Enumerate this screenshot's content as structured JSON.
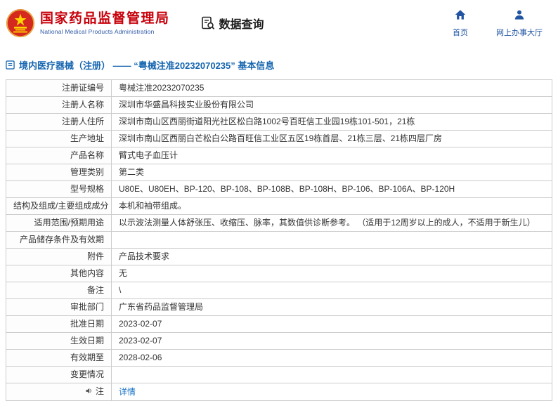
{
  "header": {
    "org_name_zh": "国家药品监督管理局",
    "org_name_en": "National Medical Products Administration",
    "nav_title": "数据查询",
    "links": [
      {
        "label": "首页",
        "icon": "home-icon"
      },
      {
        "label": "网上办事大厅",
        "icon": "person-icon"
      }
    ]
  },
  "breadcrumb": {
    "title": "境内医疗器械（注册） —— “粤械注准20232070235” 基本信息"
  },
  "colors": {
    "brand_red": "#c7000b",
    "nav_blue": "#2155a3",
    "title_blue": "#1565b0",
    "link_blue": "#1a73c7",
    "table_border": "#cccccc"
  },
  "table": {
    "rows": [
      {
        "label": "注册证编号",
        "value": "粤械注准20232070235"
      },
      {
        "label": "注册人名称",
        "value": "深圳市华盛昌科技实业股份有限公司"
      },
      {
        "label": "注册人住所",
        "value": "深圳市南山区西丽街道阳光社区松白路1002号百旺信工业园19栋101-501，21栋"
      },
      {
        "label": "生产地址",
        "value": "深圳市南山区西丽白芒松白公路百旺信工业区五区19栋首层、21栋三层、21栋四层厂房"
      },
      {
        "label": "产品名称",
        "value": "臂式电子血压计"
      },
      {
        "label": "管理类别",
        "value": "第二类"
      },
      {
        "label": "型号规格",
        "value": "U80E、U80EH、BP-120、BP-108、BP-108B、BP-108H、BP-106、BP-106A、BP-120H"
      },
      {
        "label": "结构及组成/主要组成成分",
        "value": "本机和袖带组成。"
      },
      {
        "label": "适用范围/预期用途",
        "value": "以示波法测量人体舒张压、收缩压、脉率，其数值供诊断参考。 （适用于12周岁以上的成人，不适用于新生儿）"
      },
      {
        "label": "产品储存条件及有效期",
        "value": ""
      },
      {
        "label": "附件",
        "value": "产品技术要求"
      },
      {
        "label": "其他内容",
        "value": "无"
      },
      {
        "label": "备注",
        "value": "\\"
      },
      {
        "label": "审批部门",
        "value": "广东省药品监督管理局"
      },
      {
        "label": "批准日期",
        "value": "2023-02-07"
      },
      {
        "label": "生效日期",
        "value": "2023-02-07"
      },
      {
        "label": "有效期至",
        "value": "2028-02-06"
      },
      {
        "label": "变更情况",
        "value": ""
      },
      {
        "label": "注",
        "label_icon": "speaker-icon",
        "value": "详情",
        "value_is_link": true
      }
    ]
  }
}
